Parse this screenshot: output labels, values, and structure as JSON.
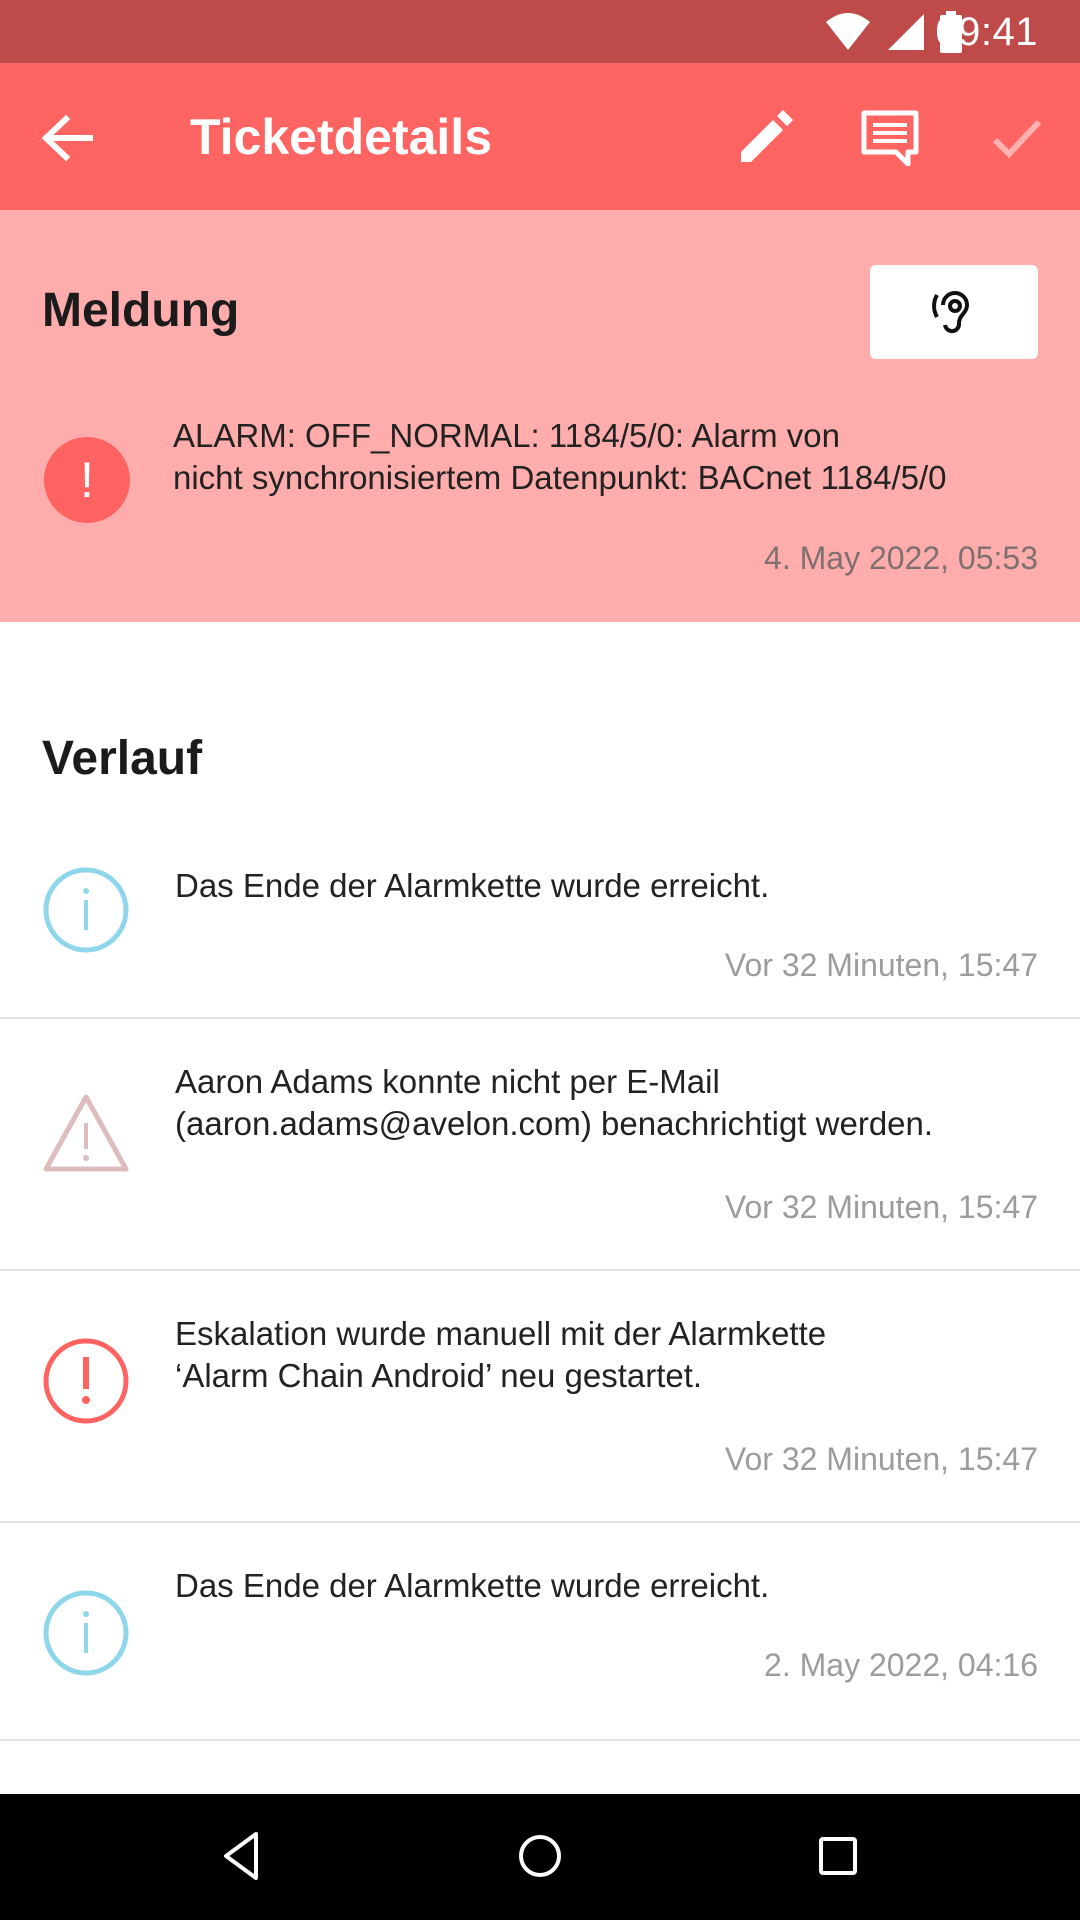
{
  "status_bar": {
    "time": "09:41",
    "icons": [
      "wifi-icon",
      "signal-icon",
      "battery-icon"
    ]
  },
  "app_bar": {
    "title": "Ticketdetails",
    "back_icon": "arrow-left-icon",
    "actions": [
      "edit-pencil-icon",
      "comment-icon",
      "check-icon"
    ]
  },
  "meldung": {
    "heading": "Meldung",
    "action_icon": "hearing-icon",
    "icon": "exclamation-icon",
    "text_line1": "ALARM: OFF_NORMAL: 1184/5/0: Alarm von",
    "text_line2": "nicht synchronisiertem Datenpunkt: BACnet 1184/5/0",
    "timestamp": "4. May 2022, 05:53"
  },
  "verlauf": {
    "heading": "Verlauf",
    "items": [
      {
        "type": "info",
        "line1": "Das Ende der Alarmkette wurde erreicht.",
        "line2": "",
        "timestamp": "Vor 32 Minuten, 15:47"
      },
      {
        "type": "warning",
        "line1": "Aaron Adams konnte nicht per E-Mail",
        "line2": "(aaron.adams@avelon.com) benachrichtigt werden.",
        "timestamp": "Vor 32 Minuten, 15:47"
      },
      {
        "type": "alarm",
        "line1": "Eskalation wurde manuell mit der Alarmkette",
        "line2": "‘Alarm Chain Android’ neu gestartet.",
        "timestamp": "Vor 32 Minuten, 15:47"
      },
      {
        "type": "info",
        "line1": "Das Ende der Alarmkette wurde erreicht.",
        "line2": "",
        "timestamp": "2. May 2022, 04:16"
      }
    ]
  },
  "colors": {
    "status_bar": "#bf4a4a",
    "app_bar": "#fe6461",
    "meldung_bg": "#ffadac",
    "alarm_red": "#ff6361",
    "info_blue": "#8ed6ea",
    "warning_pink": "#dcbcbc"
  },
  "nav_bar": [
    "back-triangle-icon",
    "home-circle-icon",
    "recents-square-icon"
  ]
}
